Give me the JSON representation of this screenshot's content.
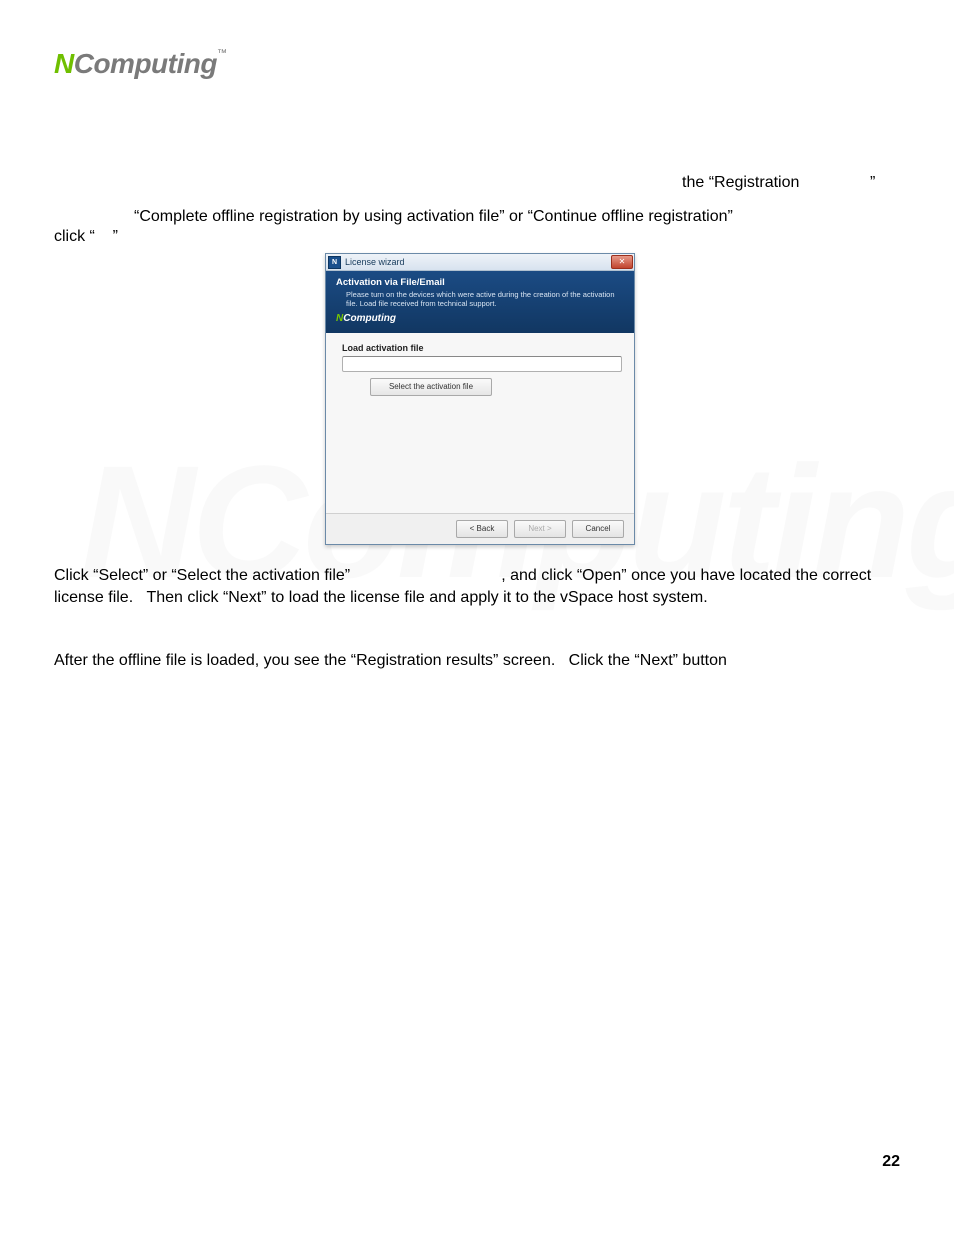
{
  "logo": {
    "brand": "NComputing",
    "tm": "™"
  },
  "para": {
    "line1a": "the “Registration",
    "line1b": "”",
    "line2": "“Complete offline registration by using activation file” or “Continue offline registration”",
    "line3": "click “    ”"
  },
  "para2": "Click “Select” or “Select the activation file”                                  , and click “Open” once you have located the correct license file.   Then click “Next” to load the license file and apply it to the vSpace host system.",
  "para3": "After the offline file is loaded, you see the “Registration results” screen.   Click the “Next” button",
  "page_number": "22",
  "dialog": {
    "app_icon_letter": "N",
    "title": "License wizard",
    "close_label": "✕",
    "header_title": "Activation via File/Email",
    "header_sub": "Please turn on the devices which were active during the creation of the activation file. Load file received from technical support.",
    "brand_n": "N",
    "brand_rest": "Computing",
    "body_label": "Load activation file",
    "select_btn": "Select the activation file",
    "back_btn": "< Back",
    "next_btn": "Next >",
    "cancel_btn": "Cancel"
  },
  "watermark": "NComputing"
}
